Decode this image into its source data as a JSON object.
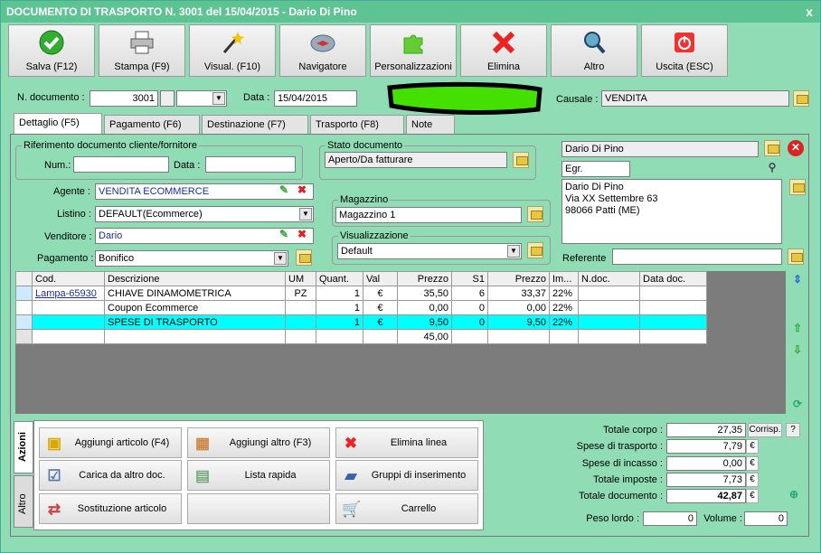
{
  "window": {
    "title": "DOCUMENTO DI TRASPORTO N. 3001 del 15/04/2015 - Dario Di Pino",
    "close": "x"
  },
  "toolbar": [
    {
      "label": "Salva (F12)",
      "icon": "check-icon"
    },
    {
      "label": "Stampa (F9)",
      "icon": "printer-icon"
    },
    {
      "label": "Visual. (F10)",
      "icon": "magic-wand-icon"
    },
    {
      "label": "Navigatore",
      "icon": "compass-icon"
    },
    {
      "label": "Personalizzazioni",
      "icon": "puzzle-icon"
    },
    {
      "label": "Elimina",
      "icon": "delete-x-icon"
    },
    {
      "label": "Altro",
      "icon": "search-icon"
    },
    {
      "label": "Uscita (ESC)",
      "icon": "power-icon"
    }
  ],
  "header": {
    "num_label": "N. documento :",
    "num_value": "3001",
    "data_label": "Data :",
    "data_value": "15/04/2015",
    "causale_label": "Causale :",
    "causale_value": "VENDITA"
  },
  "tabs": [
    "Dettaglio (F5)",
    "Pagamento (F6)",
    "Destinazione (F7)",
    "Trasporto (F8)",
    "Note"
  ],
  "riferimento": {
    "title": "Riferimento documento cliente/fornitore",
    "num_label": "Num.:",
    "data_label": "Data :"
  },
  "stato": {
    "title": "Stato documento",
    "value": "Aperto/Da fatturare"
  },
  "magazzino": {
    "title": "Magazzino",
    "value": "Magazzino 1"
  },
  "visualizzazione": {
    "title": "Visualizzazione",
    "value": "Default"
  },
  "fields": {
    "agente_label": "Agente :",
    "agente_value": "VENDITA ECOMMERCE",
    "listino_label": "Listino :",
    "listino_value": "DEFAULT(Ecommerce)",
    "venditore_label": "Venditore :",
    "venditore_value": "Dario",
    "pagamento_label": "Pagamento :",
    "pagamento_value": "Bonifico"
  },
  "cliente": {
    "name": "Dario Di Pino",
    "title": "Egr.",
    "address": [
      "Dario Di Pino",
      "Via XX Settembre 63",
      "98066 Patti (ME)"
    ],
    "referente_label": "Referente"
  },
  "grid": {
    "columns": [
      "Cod.",
      "Descrizione",
      "UM",
      "Quant.",
      "Val",
      "Prezzo",
      "S1",
      "Prezzo",
      "Im...",
      "N.doc.",
      "Data doc."
    ],
    "rows": [
      [
        "Lampa-65930",
        "CHIAVE DINAMOMETRICA",
        "PZ",
        "1",
        "€",
        "35,50",
        "6",
        "33,37",
        "22%",
        "",
        ""
      ],
      [
        "",
        "Coupon Ecommerce",
        "",
        "1",
        "€",
        "0,00",
        "0",
        "0,00",
        "22%",
        "",
        ""
      ],
      [
        "",
        "SPESE DI TRASPORTO",
        "",
        "1",
        "€",
        "9,50",
        "0",
        "9,50",
        "22%",
        "",
        ""
      ],
      [
        "",
        "",
        "",
        "",
        "",
        "45,00",
        "",
        "",
        "",
        "",
        ""
      ]
    ]
  },
  "side_tabs": [
    "Azioni",
    "Altro"
  ],
  "actions": [
    {
      "label": "Aggiungi articolo (F4)",
      "icon": "add-box-icon"
    },
    {
      "label": "Aggiungi altro (F3)",
      "icon": "add-grid-icon"
    },
    {
      "label": "Elimina linea",
      "icon": "delete-x-icon"
    },
    {
      "label": "Carica da altro doc.",
      "icon": "load-doc-icon"
    },
    {
      "label": "Lista rapida",
      "icon": "quick-list-icon"
    },
    {
      "label": "Gruppi di inserimento",
      "icon": "groups-icon"
    },
    {
      "label": "Sostituzione articolo",
      "icon": "replace-icon"
    },
    {
      "label": "",
      "icon": ""
    },
    {
      "label": "Carrello",
      "icon": "cart-icon"
    }
  ],
  "totals": {
    "corpo_label": "Totale corpo :",
    "corpo_value": "27,35",
    "corrisp": "Corrisp.",
    "help": "?",
    "trasporto_label": "Spese di trasporto :",
    "trasporto_value": "7,79",
    "incasso_label": "Spese di incasso :",
    "incasso_value": "0,00",
    "imposte_label": "Totale imposte :",
    "imposte_value": "7,73",
    "documento_label": "Totale documento :",
    "documento_value": "42,87",
    "currency": "€",
    "peso_label": "Peso lordo :",
    "peso_value": "0",
    "volume_label": "Volume :",
    "volume_value": "0"
  },
  "colors": {
    "window_bg": "#8fdcb5",
    "title_bg": "#5dc392",
    "highlight_row": "#00ffff",
    "redaction": "#44e000"
  }
}
